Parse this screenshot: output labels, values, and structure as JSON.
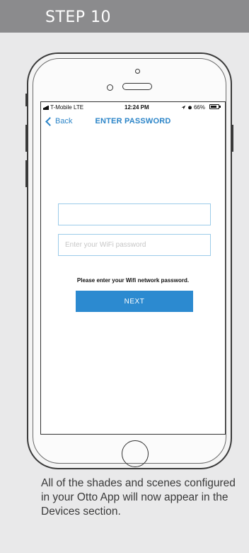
{
  "header": {
    "title": "STEP 10"
  },
  "phone": {
    "status": {
      "carrier": "T-Mobile  LTE",
      "time": "12:24 PM",
      "battery": "66%"
    },
    "nav": {
      "back_label": "Back",
      "title": "ENTER PASSWORD"
    },
    "ssid_field": {
      "value": "",
      "placeholder": ""
    },
    "password_field": {
      "value": "",
      "placeholder": "Enter your WiFi password"
    },
    "hint": "Please enter your Wifi network password.",
    "next_label": "NEXT"
  },
  "caption": "All of the shades and scenes configured in your Otto App will now appear in the Devices section.",
  "colors": {
    "accent": "#2c8ad0",
    "header_bg": "#8b8b8d",
    "panel_bg": "#e9e9ea"
  },
  "icons": [
    "signal-icon",
    "location-icon",
    "alarm-icon",
    "battery-icon",
    "back-chevron-icon"
  ]
}
